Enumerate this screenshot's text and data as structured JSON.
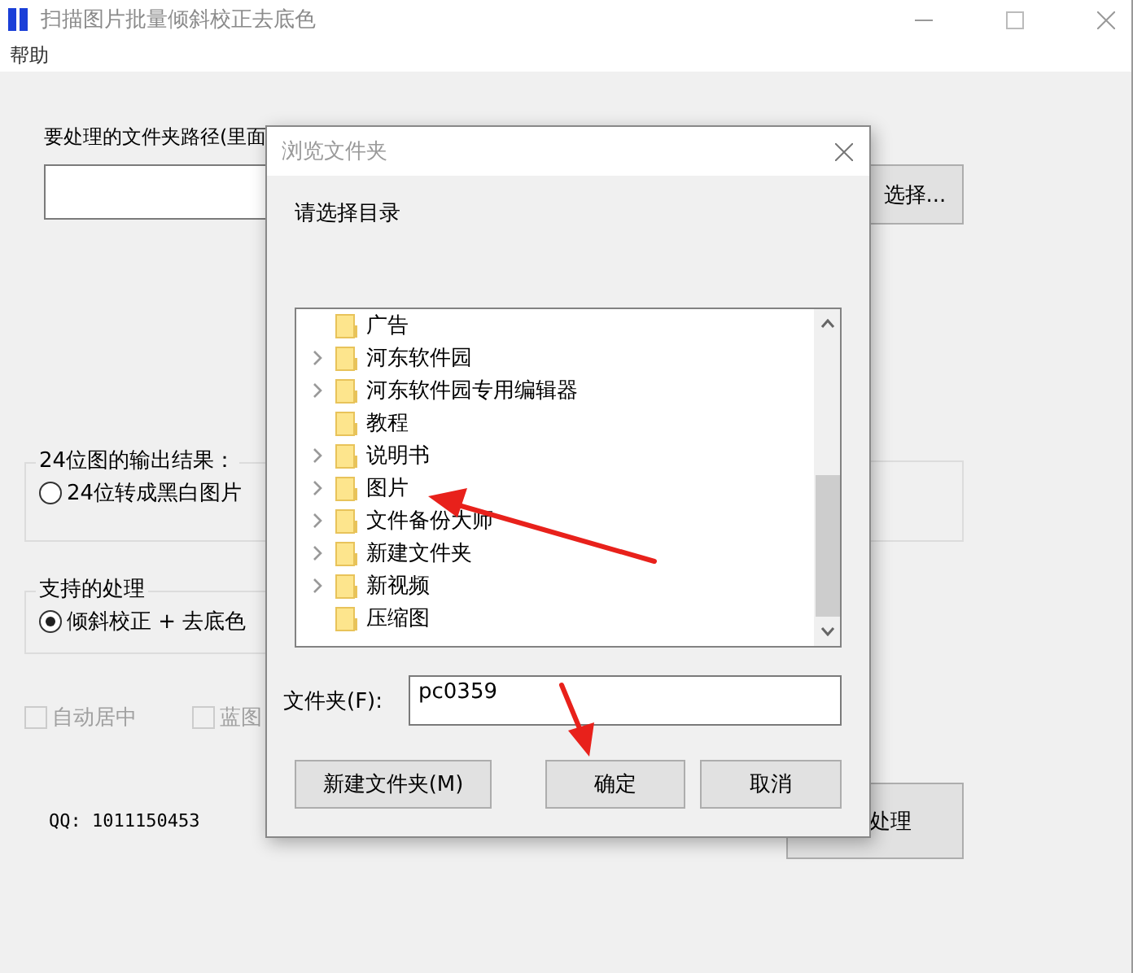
{
  "window": {
    "title": "扫描图片批量倾斜校正去底色",
    "menu": [
      "帮助"
    ]
  },
  "main": {
    "path_label": "要处理的文件夹路径(里面",
    "choose_button": "选择...",
    "output_group": {
      "title": "24位图的输出结果：",
      "options": [
        {
          "label": "24位转成黑白图片",
          "selected": false
        }
      ]
    },
    "process_group": {
      "title": "支持的处理",
      "options": [
        {
          "label": "倾斜校正 + 去底色",
          "selected": true
        }
      ]
    },
    "checkboxes": [
      {
        "label": "自动居中",
        "checked": false,
        "disabled": true
      },
      {
        "label": "蓝图",
        "checked": false,
        "disabled": true
      }
    ],
    "qq": "QQ: 1011150453",
    "start_button": "处理"
  },
  "dialog": {
    "title": "浏览文件夹",
    "prompt": "请选择目录",
    "tree": [
      {
        "label": "广告",
        "expandable": false
      },
      {
        "label": "河东软件园",
        "expandable": true
      },
      {
        "label": "河东软件园专用编辑器",
        "expandable": true
      },
      {
        "label": "教程",
        "expandable": false
      },
      {
        "label": "说明书",
        "expandable": true
      },
      {
        "label": "图片",
        "expandable": true
      },
      {
        "label": "文件备份大师",
        "expandable": true
      },
      {
        "label": "新建文件夹",
        "expandable": true
      },
      {
        "label": "新视频",
        "expandable": true
      },
      {
        "label": "压缩图",
        "expandable": false
      }
    ],
    "folder_label": "文件夹(F):",
    "folder_value": "pc0359",
    "buttons": [
      {
        "label": "新建文件夹(M)",
        "kind": "new"
      },
      {
        "label": "确定",
        "kind": "ok"
      },
      {
        "label": "取消",
        "kind": "cancel"
      }
    ]
  }
}
